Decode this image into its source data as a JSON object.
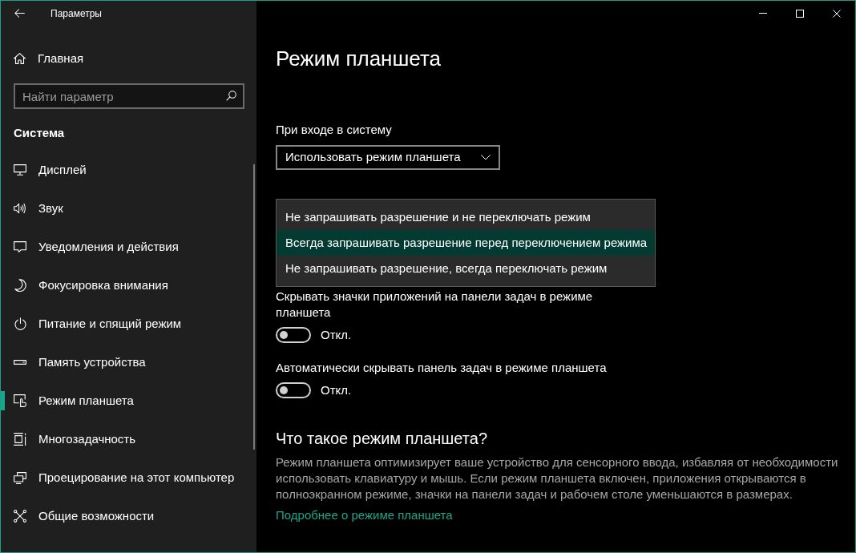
{
  "window": {
    "title": "Параметры"
  },
  "sidebar": {
    "home": {
      "label": "Главная"
    },
    "search": {
      "placeholder": "Найти параметр"
    },
    "section_title": "Система",
    "items": [
      {
        "label": "Дисплей",
        "selected": false
      },
      {
        "label": "Звук",
        "selected": false
      },
      {
        "label": "Уведомления и действия",
        "selected": false
      },
      {
        "label": "Фокусировка внимания",
        "selected": false
      },
      {
        "label": "Питание и спящий режим",
        "selected": false
      },
      {
        "label": "Память устройства",
        "selected": false
      },
      {
        "label": "Режим планшета",
        "selected": true
      },
      {
        "label": "Многозадачность",
        "selected": false
      },
      {
        "label": "Проецирование на этот компьютер",
        "selected": false
      },
      {
        "label": "Общие возможности",
        "selected": false
      }
    ]
  },
  "page": {
    "title": "Режим планшета",
    "sign_in_setting": {
      "label": "При входе в систему",
      "value": "Использовать режим планшета"
    },
    "dropdown_menu": {
      "options": [
        {
          "label": "Не запрашивать разрешение и не переключать режим",
          "selected": false
        },
        {
          "label": "Всегда запрашивать разрешение перед переключением режима",
          "selected": true
        },
        {
          "label": "Не запрашивать разрешение, всегда переключать режим",
          "selected": false
        }
      ]
    },
    "toggles": [
      {
        "label": "Скрывать значки приложений на панели задач в режиме планшета",
        "on": false,
        "state_text": "Откл."
      },
      {
        "label": "Автоматически скрывать панель задач в режиме планшета",
        "on": false,
        "state_text": "Откл."
      }
    ],
    "info": {
      "heading": "Что такое режим планшета?",
      "text": "Режим планшета оптимизирует ваше устройство для сенсорного ввода, избавляя от необходимости использовать клавиатуру и мышь. Если режим планшета включен, приложения открываются в полноэкранном режиме, значки на панели задач и рабочем столе уменьшаются в размерах.",
      "link": "Подробнее о режиме планшета"
    }
  }
}
